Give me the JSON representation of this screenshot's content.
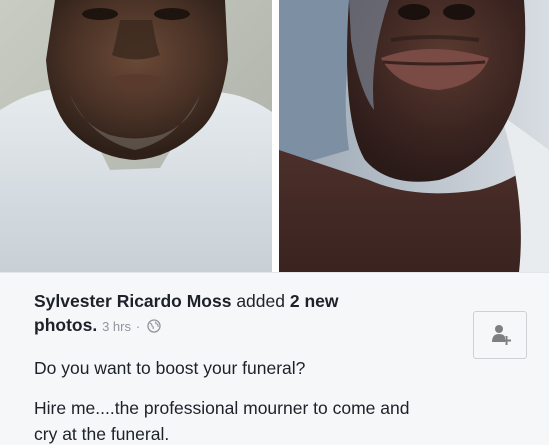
{
  "post": {
    "author": "Sylvester Ricardo Moss",
    "action_text": "added",
    "count_text": "2 new",
    "object_text": "photos.",
    "timestamp": "3 hrs",
    "separator": "·",
    "privacy_icon": "globe-icon",
    "add_friend_icon": "add-friend-icon",
    "body_line_1": "Do you want to boost your funeral?",
    "body_line_2": "Hire me....the professional mourner to come and",
    "body_line_3": "cry at the funeral."
  },
  "photos": [
    {
      "name": "photo-left",
      "icon": "portrait-photo"
    },
    {
      "name": "photo-right",
      "icon": "portrait-photo"
    }
  ],
  "colors": {
    "text": "#1d2129",
    "muted": "#90949c",
    "panel": "#f6f7f9",
    "border": "#ced0d4"
  }
}
